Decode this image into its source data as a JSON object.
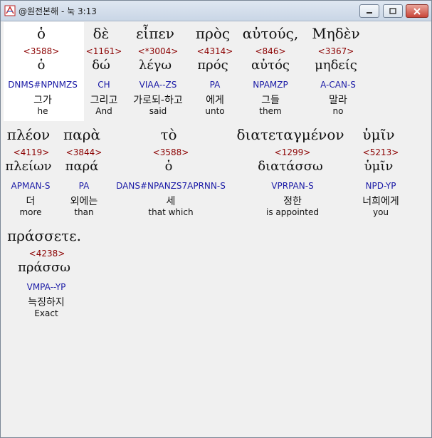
{
  "window": {
    "title": "@원전본해 - 눅 3:13",
    "app_icon": "bible-app-icon",
    "buttons": [
      "minimize-icon",
      "maximize-icon",
      "close-icon"
    ]
  },
  "colors": {
    "strong": "#8b0000",
    "morph": "#1a1aa6",
    "text": "#111111"
  },
  "rows": [
    {
      "words": [
        {
          "greek": "ὁ",
          "strong": "<3588>",
          "lemma": "ὁ",
          "morph": "DNMS#NPNMZS",
          "korean": "그가",
          "english": "he"
        },
        {
          "greek": "δὲ",
          "strong": "<1161>",
          "lemma": "δώ",
          "morph": "CH",
          "korean": "그리고",
          "english": "And"
        },
        {
          "greek": "εἶπεν",
          "strong": "<*3004>",
          "lemma": "λέγω",
          "morph": "VIAA--ZS",
          "korean": "가로되-하고",
          "english": "said"
        },
        {
          "greek": "πρὸς",
          "strong": "<4314>",
          "lemma": "πρός",
          "morph": "PA",
          "korean": "에게",
          "english": "unto"
        },
        {
          "greek": "αὐτούς,",
          "strong": "<846>",
          "lemma": "αὐτός",
          "morph": "NPAMZP",
          "korean": "그들",
          "english": "them"
        },
        {
          "greek": "Μηδὲν",
          "strong": "<3367>",
          "lemma": "μηδείς",
          "morph": "A-CAN-S",
          "korean": "말라",
          "english": "no"
        }
      ]
    },
    {
      "words": [
        {
          "greek": "πλέον",
          "strong": "<4119>",
          "lemma": "πλείων",
          "morph": "APMAN-S",
          "korean": "더",
          "english": "more"
        },
        {
          "greek": "παρὰ",
          "strong": "<3844>",
          "lemma": "παρά",
          "morph": "PA",
          "korean": "외에는",
          "english": "than"
        },
        {
          "greek": "τὸ",
          "strong": "<3588>",
          "lemma": "ὁ",
          "morph": "DANS#NPANZS7APRNN-S",
          "korean": "세",
          "english": "that which"
        },
        {
          "greek": "διατεταγμένον",
          "strong": "<1299>",
          "lemma": "διατάσσω",
          "morph": "VPRPAN-S",
          "korean": "정한",
          "english": "is appointed"
        },
        {
          "greek": "ὑμῖν",
          "strong": "<5213>",
          "lemma": "ὑμῖν",
          "morph": "NPD-YP",
          "korean": "너희에게",
          "english": "you"
        }
      ]
    },
    {
      "words": [
        {
          "greek": "πράσσετε.",
          "strong": "<4238>",
          "lemma": "πράσσω",
          "morph": "VMPA--YP",
          "korean": "늑징하지",
          "english": "Exact"
        }
      ]
    }
  ]
}
